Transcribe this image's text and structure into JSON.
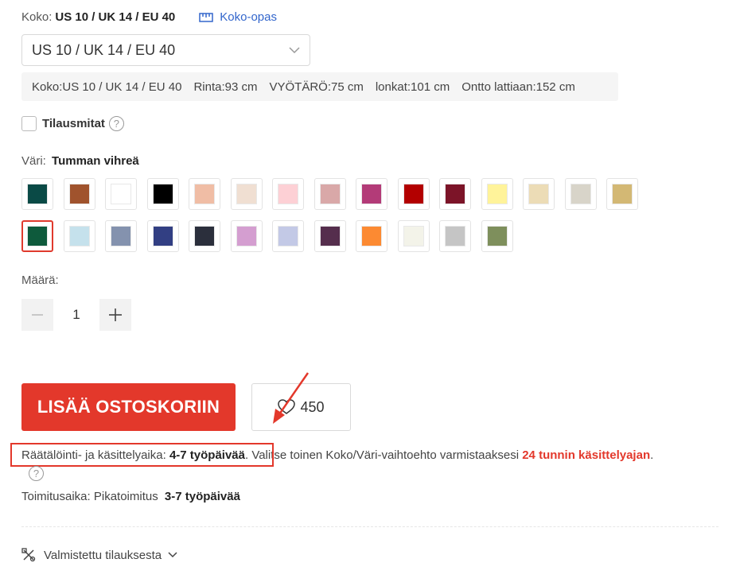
{
  "size": {
    "label": "Koko:",
    "value": "US 10 / UK 14 / EU 40",
    "guide_label": "Koko-opas",
    "guide_icon": "ruler-icon",
    "select_value": "US 10 / UK 14 / EU 40"
  },
  "measurements": [
    "Koko:US 10 / UK 14 / EU 40",
    "Rinta:93 cm",
    "VYÖTÄRÖ:75 cm",
    "lonkat:101 cm",
    "Ontto lattiaan:152 cm"
  ],
  "custom": {
    "label": "Tilausmitat",
    "help_glyph": "?"
  },
  "color": {
    "label": "Väri:",
    "value": "Tumman vihreä",
    "swatches": [
      "#0a4a46",
      "#a0532d",
      "#ffffff",
      "#000000",
      "#f0bda5",
      "#f0dfd2",
      "#fdd0d5",
      "#d9a8a8",
      "#b33b78",
      "#b30000",
      "#7c1428",
      "#fff39a",
      "#ecdcb6",
      "#d8d4c9",
      "#d3b874",
      "#0e5a3c",
      "#c5e1ec",
      "#8492ae",
      "#323f83",
      "#2b2f3c",
      "#d49ed0",
      "#c3c9e6",
      "#552e4d",
      "#fc8a32",
      "#f3f3e9",
      "#c5c5c5",
      "#7e8f5c"
    ],
    "selected_index": 15,
    "accent": "#e3382b"
  },
  "quantity": {
    "label": "Määrä:",
    "value": "1",
    "minus": "−",
    "plus": "+"
  },
  "actions": {
    "add_to_cart": "LISÄÄ OSTOSKORIIN",
    "wishlist_count": "450"
  },
  "tailoring": {
    "prefix": "Räätälöinti- ja käsittelyaika:",
    "days": "4-7 työpäivää",
    "middle": ". Valitse toinen Koko/Väri-vaihtoehto varmistaaksesi",
    "highlight": "24 tunnin käsittelyajan",
    "suffix": ".",
    "help_glyph": "?"
  },
  "shipping": {
    "label": "Toimitusaika: Pikatoimitus",
    "value": "3-7 työpäivää"
  },
  "made_to_order": {
    "label": "Valmistettu tilauksesta"
  }
}
